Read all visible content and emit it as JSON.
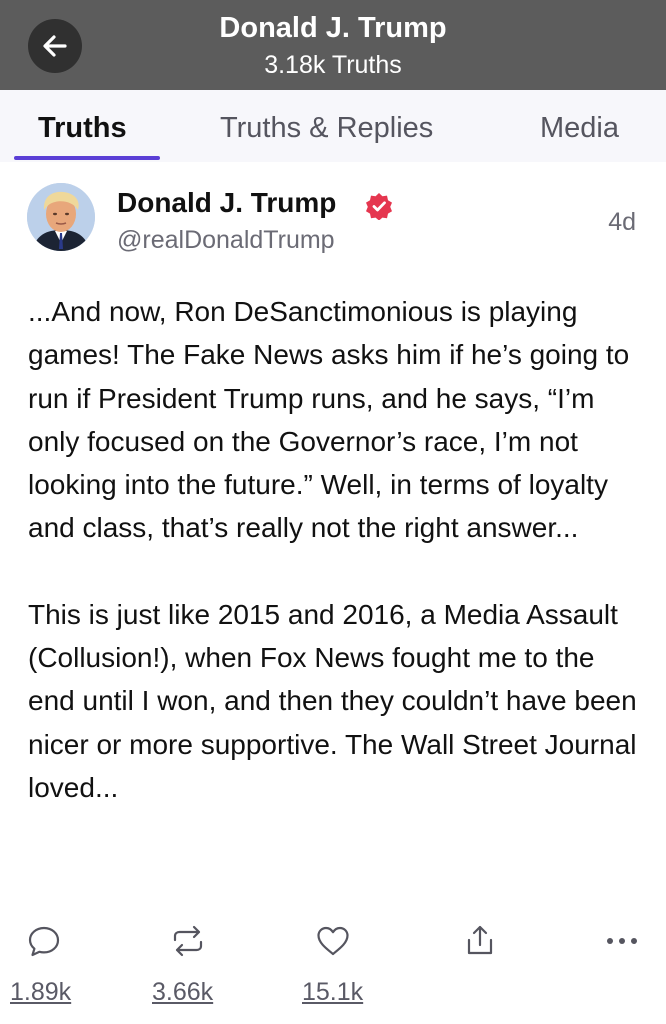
{
  "header": {
    "title": "Donald J. Trump",
    "subtitle": "3.18k Truths",
    "back_icon": "arrow-left-icon"
  },
  "tabs": [
    {
      "label": "Truths",
      "active": true
    },
    {
      "label": "Truths & Replies",
      "active": false
    },
    {
      "label": "Media",
      "active": false
    }
  ],
  "colors": {
    "header_bg": "#5c5c5c",
    "accent": "#5b3fd6",
    "verified": "#e5364f"
  },
  "post": {
    "author_name": "Donald J. Trump",
    "handle": "@realDonaldTrump",
    "time": "4d",
    "verified_icon": "verified-badge-icon",
    "paragraphs": [
      "...And now, Ron DeSanctimonious is playing games! The Fake News asks him if he’s going to run if President Trump runs, and he says, “I’m only focused on the Governor’s race, I’m not looking into the future.” Well, in terms of loyalty and class, that’s really not the right answer...",
      "This is just like 2015 and 2016, a Media Assault (Collusion!), when Fox News fought me to the end until I won, and then they couldn’t have been nicer or more supportive. The Wall Street Journal loved..."
    ],
    "actions": {
      "reply": {
        "icon": "reply-icon",
        "count": "1.89k"
      },
      "retruth": {
        "icon": "retruth-icon",
        "count": "3.66k"
      },
      "like": {
        "icon": "heart-icon",
        "count": "15.1k"
      },
      "share": {
        "icon": "share-icon"
      },
      "more": {
        "icon": "more-icon"
      }
    }
  }
}
